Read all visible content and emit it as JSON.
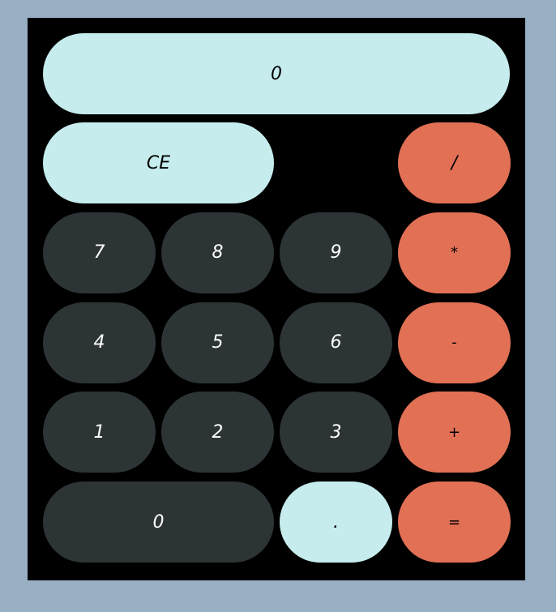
{
  "display": {
    "value": "0"
  },
  "keys": {
    "clear": "CE",
    "divide": "/",
    "multiply": "*",
    "minus": "-",
    "plus": "+",
    "equals": "=",
    "decimal": ".",
    "seven": "7",
    "eight": "8",
    "nine": "9",
    "four": "4",
    "five": "5",
    "six": "6",
    "one": "1",
    "two": "2",
    "three": "3",
    "zero": "0"
  },
  "colors": {
    "page_background": "#98afc4",
    "body_background": "#000000",
    "light_key": "#c6eced",
    "number_key": "#2d3436",
    "operator_key": "#e17055"
  }
}
